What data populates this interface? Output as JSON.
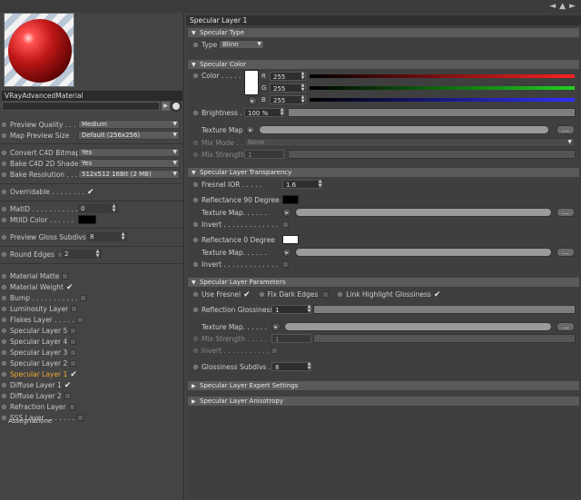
{
  "window": {
    "nav_back": "◄",
    "nav_up": "▲",
    "nav_fwd": "►"
  },
  "material": {
    "name": "VRayAdvancedMaterial"
  },
  "left_params": {
    "preview_quality": {
      "label": "Preview Quality . . .",
      "value": "Medium"
    },
    "map_preview_size": {
      "label": "Map Preview Size",
      "value": "Default (256x256)"
    },
    "convert_c4d_bitmaps": {
      "label": "Convert C4D Bitmaps",
      "value": "Yes"
    },
    "bake_c4d_2d_shaders": {
      "label": "Bake C4D 2D Shaders",
      "value": "Yes"
    },
    "bake_resolution": {
      "label": "Bake Resolution . . .",
      "value": "512x512  16Bit  (2 MB)"
    },
    "overridable": {
      "label": "Overridable . . . . . . . .",
      "checked": true
    },
    "matid": {
      "label": "MatID . . . . . . . . . . .",
      "value": "0"
    },
    "mtlid_color": {
      "label": "MtlID Color . . . . . ."
    },
    "preview_gloss_subdivs": {
      "label": "Preview Gloss Subdivs",
      "value": "8"
    },
    "round_edges": {
      "label": "Round Edges",
      "value": "2"
    }
  },
  "layers": [
    {
      "label": "Material Matte",
      "checked": false
    },
    {
      "label": "Material Weight",
      "checked": true
    },
    {
      "label": "Bump . . . . . . . . . . .",
      "checked": false
    },
    {
      "label": "Luminosity Layer",
      "checked": false
    },
    {
      "label": "Flakes Layer . . . . .",
      "checked": false
    },
    {
      "label": "Specular Layer 5",
      "checked": false
    },
    {
      "label": "Specular Layer 4",
      "checked": false
    },
    {
      "label": "Specular Layer 3",
      "checked": false
    },
    {
      "label": "Specular Layer 2",
      "checked": false
    },
    {
      "label": "Specular Layer 1",
      "checked": true,
      "active": true
    },
    {
      "label": "Diffuse Layer 1",
      "checked": true
    },
    {
      "label": "Diffuse Layer 2",
      "checked": false
    },
    {
      "label": "Refraction Layer",
      "checked": false
    },
    {
      "label": "SSS Layer . . . . . . .",
      "checked": false
    }
  ],
  "assegnazione": "Assegnazione",
  "right": {
    "title": "Specular Layer 1",
    "specular_type": {
      "header": "Specular Type",
      "type_label": "Type",
      "type_value": "Blinn"
    },
    "specular_color": {
      "header": "Specular Color",
      "color_label": "Color . . . . .",
      "r_label": "R",
      "r_value": "255",
      "g_label": "G",
      "g_value": "255",
      "b_label": "B",
      "b_value": "255",
      "brightness_label": "Brightness . .",
      "brightness_value": "100 %",
      "texture_map_label": "Texture Map",
      "mix_mode_label": "Mix Mode . . .",
      "mix_mode_value": "None",
      "mix_strength_label": "Mix Strength",
      "mix_strength_value": "1"
    },
    "transparency": {
      "header": "Specular Layer Transparency",
      "fresnel_ior_label": "Fresnel IOR . . . . .",
      "fresnel_ior_value": "1.6",
      "refl90_label": "Reflectance 90 Degree",
      "texture_map_label": "Texture Map. . . . . .",
      "invert_label": "Invert . . . . . . . . . . . . .",
      "refl0_label": "Reflectance  0 Degree",
      "texture_map2_label": "Texture Map. . . . . .",
      "invert2_label": "Invert . . . . . . . . . . . . ."
    },
    "parameters": {
      "header": "Specular Layer Parameters",
      "use_fresnel_label": "Use Fresnel",
      "fix_dark_edges_label": "Fix Dark Edges",
      "link_highlight_label": "Link Highlight Glossiness",
      "refl_gloss_label": "Reflection Glossiness",
      "refl_gloss_value": "1",
      "texture_map_label": "Texture Map. . . . . .",
      "mix_strength_label": "Mix Strength . . . . .",
      "mix_strength_value": "1",
      "invert_label": "Invert . . . . . . . . . . . .",
      "gloss_subdivs_label": "Glossiness Subdivs . .",
      "gloss_subdivs_value": "8"
    },
    "expert_header": "Specular Layer Expert Settings",
    "anisotropy_header": "Specular Layer Anisotropy",
    "dots_label": "..."
  }
}
